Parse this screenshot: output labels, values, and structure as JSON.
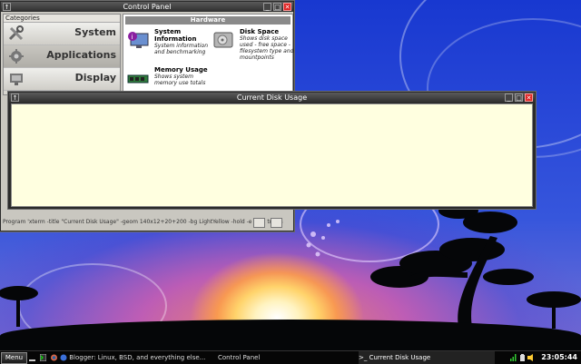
{
  "control_panel": {
    "title": "Control Panel",
    "categories_header": "Categories",
    "categories": [
      {
        "label": "System",
        "icon": "tools-icon"
      },
      {
        "label": "Applications",
        "icon": "applications-icon"
      },
      {
        "label": "Display",
        "icon": "display-icon"
      }
    ],
    "section_header": "Hardware",
    "items": [
      {
        "title": "System Information",
        "desc": "System information and benchmarking",
        "icon": "monitor-info-icon"
      },
      {
        "title": "Disk Space",
        "desc": "Shows disk space used - free space - filesystem type and mountpoints",
        "icon": "hard-disk-icon"
      },
      {
        "title": "Memory Usage",
        "desc": "Shows system memory use totals",
        "icon": "memory-chip-icon"
      }
    ],
    "status_text": "Program 'xterm -title \"Current Disk Usage\" -geom 140x12+20+200 -bg LightYellow -hold -e di -x tmpfs"
  },
  "disk_usage_window": {
    "title": "Current Disk Usage",
    "background": "#ffffe0"
  },
  "window_controls": {
    "menu": "↑",
    "minimize": "_",
    "maximize": "□",
    "close": "✕"
  },
  "taskbar": {
    "menu_label": "Menu",
    "tasks": [
      {
        "label": "Blogger: Linux, BSD, and everything else...",
        "active": false
      },
      {
        "label": "Control Panel",
        "active": false
      },
      {
        "label": "Current Disk Usage",
        "active": true
      }
    ],
    "clock": "23:05:44"
  },
  "colors": {
    "titlebar": "#3a3a3a",
    "close": "#dd2222",
    "desktop": "#2a49d8"
  }
}
